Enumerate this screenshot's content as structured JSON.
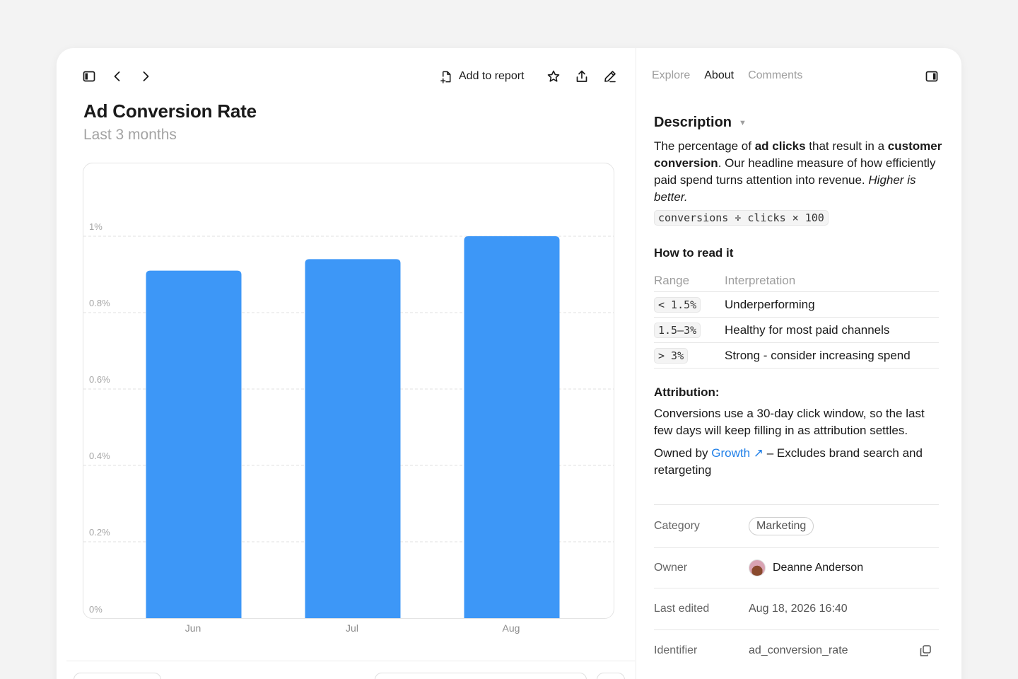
{
  "toolbar": {
    "add_to_report": "Add to report"
  },
  "header": {
    "title": "Ad Conversion Rate",
    "subtitle": "Last 3 months"
  },
  "chart_data": {
    "type": "bar",
    "categories": [
      "Jun",
      "Jul",
      "Aug"
    ],
    "values": [
      0.91,
      0.94,
      1.0
    ],
    "title": "",
    "xlabel": "",
    "ylabel": "",
    "ylim": [
      0,
      1.0
    ],
    "yticks": [
      0,
      0.2,
      0.4,
      0.6,
      0.8,
      1.0
    ],
    "ytick_labels": [
      "0%",
      "0.2%",
      "0.4%",
      "0.6%",
      "0.8%",
      "1%"
    ],
    "grid": true,
    "color": "#3d97f7"
  },
  "panel": {
    "tabs": [
      "Explore",
      "About",
      "Comments"
    ],
    "description": {
      "heading": "Description",
      "text_1": "The percentage of ",
      "bold_1": "ad clicks",
      "text_2": " that result in a ",
      "bold_2": "customer conversion",
      "text_3": ". Our headline measure of how efficiently paid spend turns attention into revenue. ",
      "italic": "Higher is better.",
      "formula": "conversions ÷ clicks × 100"
    },
    "how_to_read": {
      "heading": "How to read it",
      "columns": [
        "Range",
        "Interpretation"
      ],
      "rows": [
        {
          "range": "< 1.5%",
          "meaning": "Underperforming"
        },
        {
          "range": "1.5–3%",
          "meaning": "Healthy for most paid channels"
        },
        {
          "range": "> 3%",
          "meaning": "Strong - consider increasing spend"
        }
      ]
    },
    "attribution": {
      "heading": "Attribution:",
      "text": "Conversions use a 30-day click window, so the last few days will keep filling in as attribution settles.",
      "owned_prefix": "Owned by ",
      "owner_link": "Growth ↗",
      "owned_suffix": " – Excludes brand search and retargeting"
    },
    "properties": {
      "category_label": "Category",
      "category_value": "Marketing",
      "owner_label": "Owner",
      "owner_value": "Deanne Anderson",
      "edited_label": "Last edited",
      "edited_value": "Aug 18, 2026 16:40",
      "identifier_label": "Identifier",
      "identifier_value": "ad_conversion_rate"
    }
  }
}
